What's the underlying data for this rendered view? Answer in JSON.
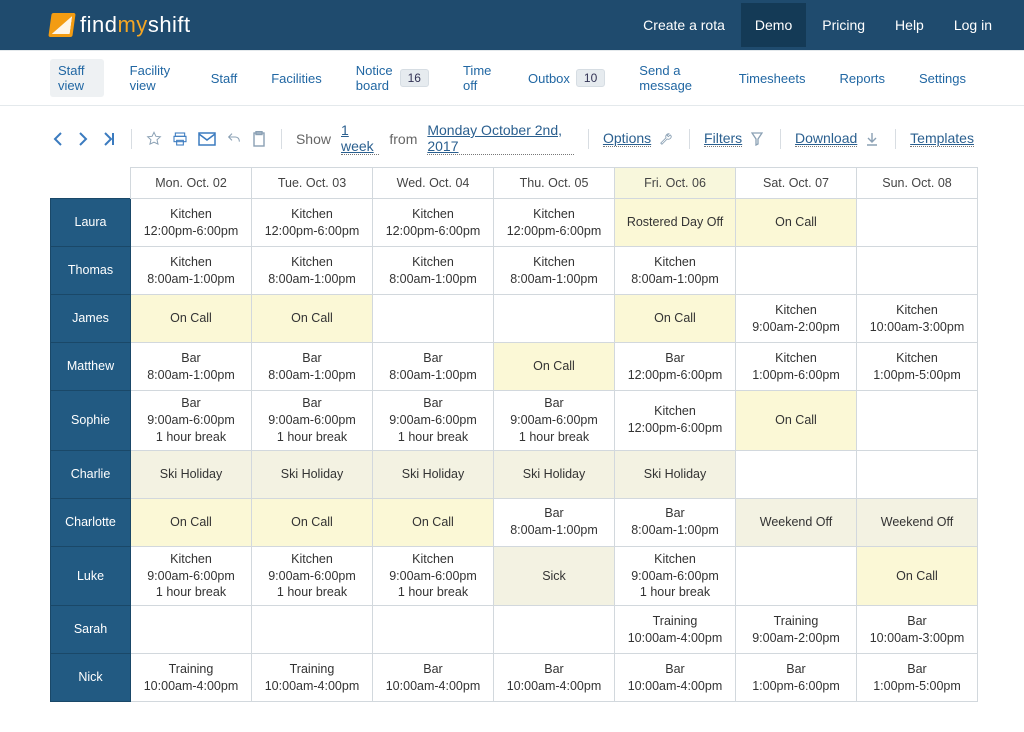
{
  "topnav": {
    "create": "Create a rota",
    "demo": "Demo",
    "pricing": "Pricing",
    "help": "Help",
    "login": "Log in"
  },
  "logo": {
    "prefix": "find",
    "mid": "my",
    "suffix": "shift"
  },
  "submenu": [
    {
      "label": "Staff view",
      "badge": null,
      "active": true
    },
    {
      "label": "Facility view",
      "badge": null
    },
    {
      "label": "Staff",
      "badge": null
    },
    {
      "label": "Facilities",
      "badge": null
    },
    {
      "label": "Notice board",
      "badge": "16"
    },
    {
      "label": "Time off",
      "badge": null
    },
    {
      "label": "Outbox",
      "badge": "10"
    },
    {
      "label": "Send a message",
      "badge": null
    },
    {
      "label": "Timesheets",
      "badge": null
    },
    {
      "label": "Reports",
      "badge": null
    },
    {
      "label": "Settings",
      "badge": null
    }
  ],
  "toolbar": {
    "show": "Show",
    "range": "1 week",
    "from": "from",
    "date": "Monday October 2nd, 2017",
    "options": "Options",
    "filters": "Filters",
    "download": "Download",
    "templates": "Templates"
  },
  "days": [
    "Mon. Oct. 02",
    "Tue. Oct. 03",
    "Wed. Oct. 04",
    "Thu. Oct. 05",
    "Fri. Oct. 06",
    "Sat. Oct. 07",
    "Sun. Oct. 08"
  ],
  "today_index": 4,
  "staff": [
    "Laura",
    "Thomas",
    "James",
    "Matthew",
    "Sophie",
    "Charlie",
    "Charlotte",
    "Luke",
    "Sarah",
    "Nick"
  ],
  "cells": [
    [
      {
        "role": "Kitchen",
        "time": "12:00pm-6:00pm"
      },
      {
        "role": "Kitchen",
        "time": "12:00pm-6:00pm"
      },
      {
        "role": "Kitchen",
        "time": "12:00pm-6:00pm"
      },
      {
        "role": "Kitchen",
        "time": "12:00pm-6:00pm"
      },
      {
        "text": "Rostered Day Off",
        "class": "oncall"
      },
      {
        "text": "On Call",
        "class": "oncall"
      },
      {}
    ],
    [
      {
        "role": "Kitchen",
        "time": "8:00am-1:00pm"
      },
      {
        "role": "Kitchen",
        "time": "8:00am-1:00pm"
      },
      {
        "role": "Kitchen",
        "time": "8:00am-1:00pm"
      },
      {
        "role": "Kitchen",
        "time": "8:00am-1:00pm"
      },
      {
        "role": "Kitchen",
        "time": "8:00am-1:00pm"
      },
      {},
      {}
    ],
    [
      {
        "text": "On Call",
        "class": "oncall"
      },
      {
        "text": "On Call",
        "class": "oncall"
      },
      {},
      {},
      {
        "text": "On Call",
        "class": "oncall"
      },
      {
        "role": "Kitchen",
        "time": "9:00am-2:00pm"
      },
      {
        "role": "Kitchen",
        "time": "10:00am-3:00pm"
      }
    ],
    [
      {
        "role": "Bar",
        "time": "8:00am-1:00pm"
      },
      {
        "role": "Bar",
        "time": "8:00am-1:00pm"
      },
      {
        "role": "Bar",
        "time": "8:00am-1:00pm"
      },
      {
        "text": "On Call",
        "class": "oncall"
      },
      {
        "role": "Bar",
        "time": "12:00pm-6:00pm"
      },
      {
        "role": "Kitchen",
        "time": "1:00pm-6:00pm"
      },
      {
        "role": "Kitchen",
        "time": "1:00pm-5:00pm"
      }
    ],
    [
      {
        "role": "Bar",
        "time": "9:00am-6:00pm",
        "extra": "1 hour break"
      },
      {
        "role": "Bar",
        "time": "9:00am-6:00pm",
        "extra": "1 hour break"
      },
      {
        "role": "Bar",
        "time": "9:00am-6:00pm",
        "extra": "1 hour break"
      },
      {
        "role": "Bar",
        "time": "9:00am-6:00pm",
        "extra": "1 hour break"
      },
      {
        "role": "Kitchen",
        "time": "12:00pm-6:00pm"
      },
      {
        "text": "On Call",
        "class": "oncall"
      },
      {}
    ],
    [
      {
        "text": "Ski Holiday",
        "class": "holiday"
      },
      {
        "text": "Ski Holiday",
        "class": "holiday"
      },
      {
        "text": "Ski Holiday",
        "class": "holiday"
      },
      {
        "text": "Ski Holiday",
        "class": "holiday"
      },
      {
        "text": "Ski Holiday",
        "class": "holiday"
      },
      {},
      {}
    ],
    [
      {
        "text": "On Call",
        "class": "oncall"
      },
      {
        "text": "On Call",
        "class": "oncall"
      },
      {
        "text": "On Call",
        "class": "oncall"
      },
      {
        "role": "Bar",
        "time": "8:00am-1:00pm"
      },
      {
        "role": "Bar",
        "time": "8:00am-1:00pm"
      },
      {
        "text": "Weekend Off",
        "class": "holiday"
      },
      {
        "text": "Weekend Off",
        "class": "holiday"
      }
    ],
    [
      {
        "role": "Kitchen",
        "time": "9:00am-6:00pm",
        "extra": "1 hour break"
      },
      {
        "role": "Kitchen",
        "time": "9:00am-6:00pm",
        "extra": "1 hour break"
      },
      {
        "role": "Kitchen",
        "time": "9:00am-6:00pm",
        "extra": "1 hour break"
      },
      {
        "text": "Sick",
        "class": "holiday"
      },
      {
        "role": "Kitchen",
        "time": "9:00am-6:00pm",
        "extra": "1 hour break"
      },
      {},
      {
        "text": "On Call",
        "class": "oncall"
      }
    ],
    [
      {},
      {},
      {},
      {},
      {
        "role": "Training",
        "time": "10:00am-4:00pm"
      },
      {
        "role": "Training",
        "time": "9:00am-2:00pm"
      },
      {
        "role": "Bar",
        "time": "10:00am-3:00pm"
      }
    ],
    [
      {
        "role": "Training",
        "time": "10:00am-4:00pm"
      },
      {
        "role": "Training",
        "time": "10:00am-4:00pm"
      },
      {
        "role": "Bar",
        "time": "10:00am-4:00pm"
      },
      {
        "role": "Bar",
        "time": "10:00am-4:00pm"
      },
      {
        "role": "Bar",
        "time": "10:00am-4:00pm"
      },
      {
        "role": "Bar",
        "time": "1:00pm-6:00pm"
      },
      {
        "role": "Bar",
        "time": "1:00pm-5:00pm"
      }
    ]
  ]
}
